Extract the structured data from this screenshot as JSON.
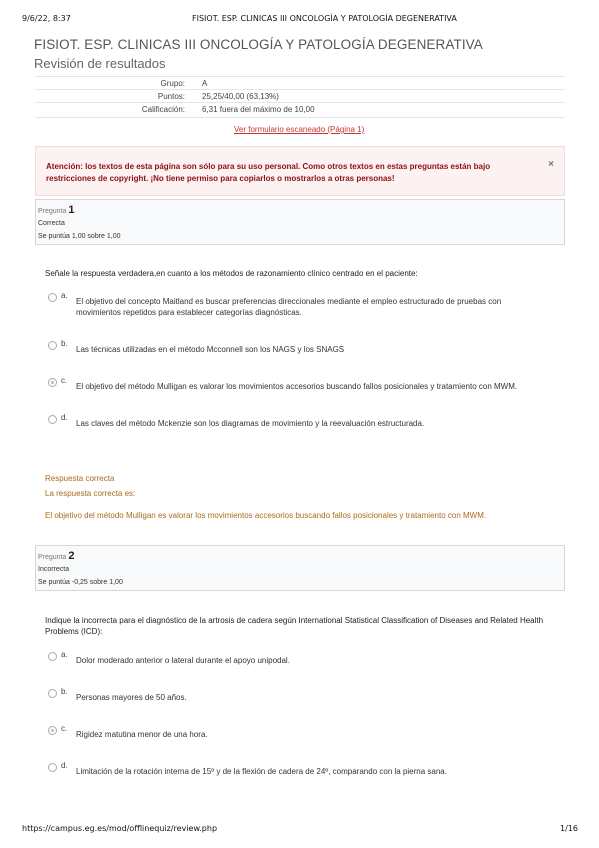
{
  "header": {
    "date": "9/6/22, 8:37",
    "doc_title": "FISIOT. ESP. CLINICAS III ONCOLOGÍA Y PATOLOGÍA DEGENERATIVA"
  },
  "page_title": "FISIOT. ESP. CLINICAS III ONCOLOGÍA Y PATOLOGÍA DEGENERATIVA",
  "page_subtitle": "Revisión de resultados",
  "summary": [
    {
      "label": "Grupo:",
      "value": "A"
    },
    {
      "label": "Puntos:",
      "value": "25,25/40,00 (63,13%)"
    },
    {
      "label": "Calificación:",
      "value": "6,31 fuera del máximo de 10,00"
    }
  ],
  "scan_link": "Ver formulario escaneado (Página 1)",
  "notice": {
    "text": "Atención: los textos de esta página son sólo para su uso personal. Como otros textos en estas preguntas están bajo restricciones de copyright. ¡No tiene permiso para copiarlos o mostrarlos a otras personas!",
    "close": "×"
  },
  "questions": [
    {
      "label": "Pregunta",
      "number": "1",
      "state": "Correcta",
      "grade": "Se puntúa 1,00 sobre 1,00",
      "text": "Señale la respuesta verdadera,en cuanto a los métodos de razonamiento clínico centrado en el paciente:",
      "options": [
        {
          "letter": "a.",
          "text": "El objetivo del concepto Maitland es buscar preferencias direccionales mediante el empleo estructurado de pruebas con movimientos repetidos para establecer categorías diagnósticas.",
          "checked": false
        },
        {
          "letter": "b.",
          "text": "Las técnicas utilizadas en el método Mcconnell son los NAGS y los SNAGS",
          "checked": false
        },
        {
          "letter": "c.",
          "text": "El objetivo del método Mulligan es valorar los movimientos accesorios buscando fallos posicionales y tratamiento con MWM.",
          "checked": true
        },
        {
          "letter": "d.",
          "text": "Las claves del método Mckenzie son los diagramas de movimiento y la reevaluación estructurada.",
          "checked": false
        }
      ],
      "feedback": {
        "title": "Respuesta correcta",
        "intro": "La respuesta correcta es:",
        "answer": "El objetivo del método Mulligan es valorar los movimientos accesorios buscando fallos posicionales y tratamiento con MWM."
      }
    },
    {
      "label": "Pregunta",
      "number": "2",
      "state": "Incorrecta",
      "grade": "Se puntúa -0,25 sobre 1,00",
      "text": "Indique la incorrecta para el diagnóstico de la artrosis de cadera según International Statistical Classification of Diseases and Related Health Problems (ICD):",
      "options": [
        {
          "letter": "a.",
          "text": "Dolor moderado anterior o lateral durante el apoyo unipodal.",
          "checked": false
        },
        {
          "letter": "b.",
          "text": "Personas mayores de 50 años.",
          "checked": false
        },
        {
          "letter": "c.",
          "text": "Rigidez matutina menor de una hora.",
          "checked": true
        },
        {
          "letter": "d.",
          "text": "Limitación de la rotación interna de 15º y de la flexión de cadera de 24º, comparando con la pierna sana.",
          "checked": false
        }
      ]
    }
  ],
  "footer": {
    "url": "https://campus.eg.es/mod/offlinequiz/review.php",
    "page": "1/16"
  }
}
